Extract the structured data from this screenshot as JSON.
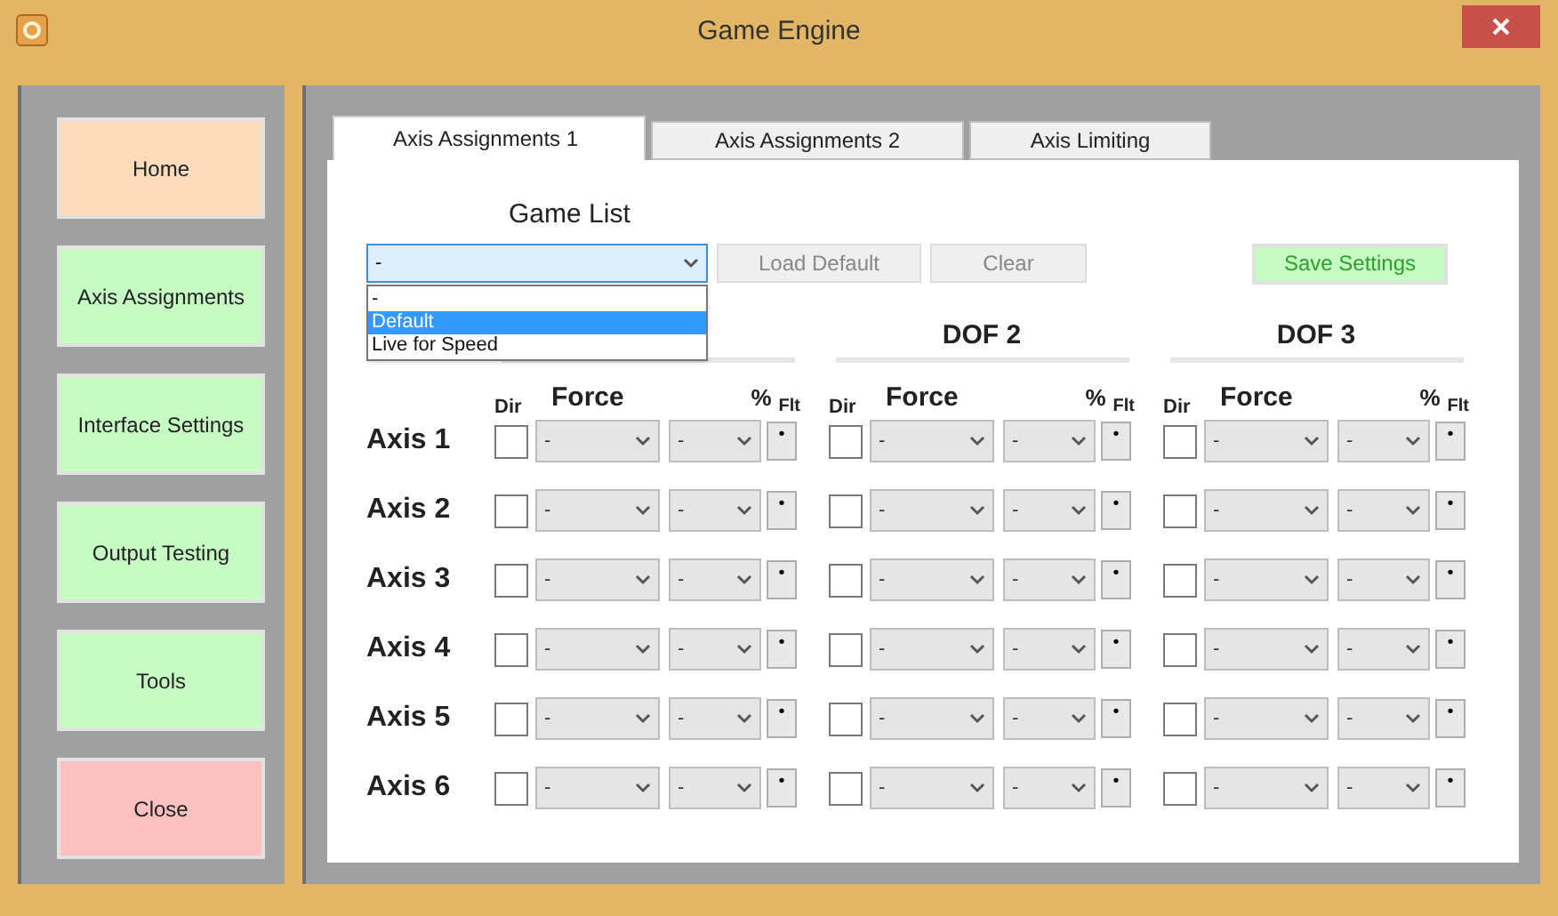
{
  "window": {
    "title": "Game Engine"
  },
  "sidebar": {
    "buttons": [
      {
        "label": "Home",
        "color": "#fddcbb"
      },
      {
        "label": "Axis Assignments",
        "color": "#c6fcc4"
      },
      {
        "label": "Interface Settings",
        "color": "#c6fcc4"
      },
      {
        "label": "Output Testing",
        "color": "#c6fcc4"
      },
      {
        "label": "Tools",
        "color": "#c6fcc4"
      },
      {
        "label": "Close",
        "color": "#fcc0c0"
      }
    ]
  },
  "tabs": [
    {
      "label": "Axis Assignments 1",
      "selected": true
    },
    {
      "label": "Axis Assignments 2",
      "selected": false
    },
    {
      "label": "Axis Limiting",
      "selected": false
    }
  ],
  "game_list": {
    "label": "Game List",
    "value": "-",
    "expanded": true,
    "options": [
      {
        "label": "-",
        "highlighted": false
      },
      {
        "label": "Default",
        "highlighted": true
      },
      {
        "label": "Live for Speed",
        "highlighted": false
      }
    ]
  },
  "buttons": [
    {
      "label": "Load Default",
      "kind": "plain"
    },
    {
      "label": "Clear",
      "kind": "plain"
    },
    {
      "label": "Save Settings",
      "kind": "save"
    }
  ],
  "dof_groups": [
    {
      "columns": [
        "Dir",
        "Force",
        "%",
        "Flt"
      ]
    },
    {
      "heading": "DOF 2",
      "columns": [
        "Dir",
        "Force",
        "%",
        "Flt"
      ]
    },
    {
      "heading": "DOF 3",
      "columns": [
        "Dir",
        "Force",
        "%",
        "Flt"
      ]
    }
  ],
  "axes": [
    {
      "label": "Axis 1",
      "cells": [
        {
          "checked": false,
          "force": "-",
          "percent": "-",
          "flt": "•"
        },
        {
          "checked": false,
          "force": "-",
          "percent": "-",
          "flt": "•"
        },
        {
          "checked": false,
          "force": "-",
          "percent": "-",
          "flt": "•"
        }
      ]
    },
    {
      "label": "Axis 2",
      "cells": [
        {
          "checked": false,
          "force": "-",
          "percent": "-",
          "flt": "•"
        },
        {
          "checked": false,
          "force": "-",
          "percent": "-",
          "flt": "•"
        },
        {
          "checked": false,
          "force": "-",
          "percent": "-",
          "flt": "•"
        }
      ]
    },
    {
      "label": "Axis 3",
      "cells": [
        {
          "checked": false,
          "force": "-",
          "percent": "-",
          "flt": "•"
        },
        {
          "checked": false,
          "force": "-",
          "percent": "-",
          "flt": "•"
        },
        {
          "checked": false,
          "force": "-",
          "percent": "-",
          "flt": "•"
        }
      ]
    },
    {
      "label": "Axis 4",
      "cells": [
        {
          "checked": false,
          "force": "-",
          "percent": "-",
          "flt": "•"
        },
        {
          "checked": false,
          "force": "-",
          "percent": "-",
          "flt": "•"
        },
        {
          "checked": false,
          "force": "-",
          "percent": "-",
          "flt": "•"
        }
      ]
    },
    {
      "label": "Axis 5",
      "cells": [
        {
          "checked": false,
          "force": "-",
          "percent": "-",
          "flt": "•"
        },
        {
          "checked": false,
          "force": "-",
          "percent": "-",
          "flt": "•"
        },
        {
          "checked": false,
          "force": "-",
          "percent": "-",
          "flt": "•"
        }
      ]
    },
    {
      "label": "Axis 6",
      "cells": [
        {
          "checked": false,
          "force": "-",
          "percent": "-",
          "flt": "•"
        },
        {
          "checked": false,
          "force": "-",
          "percent": "-",
          "flt": "•"
        },
        {
          "checked": false,
          "force": "-",
          "percent": "-",
          "flt": "•"
        }
      ]
    }
  ]
}
